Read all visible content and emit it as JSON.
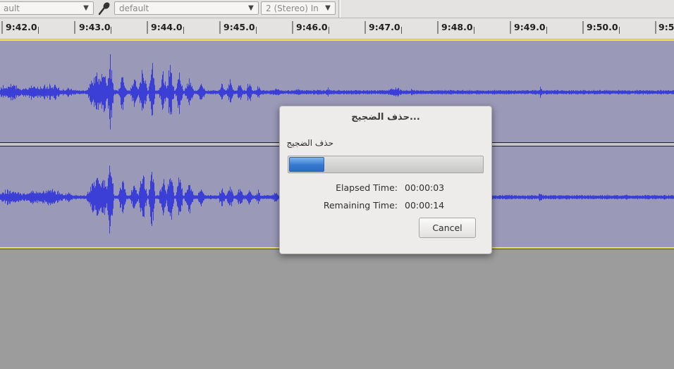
{
  "toolbar": {
    "host_select": "ault",
    "mic_icon": "microphone-icon",
    "input_device_select": "default",
    "channels_select": "2 (Stereo) In"
  },
  "ruler": {
    "ticks": [
      "9:42.0",
      "9:43.0",
      "9:44.0",
      "9:45.0",
      "9:46.0",
      "9:47.0",
      "9:48.0",
      "9:49.0",
      "9:50.0",
      "9:5"
    ]
  },
  "colors": {
    "waveform": "#3b3fd6",
    "track_background": "#9a99b8",
    "selection_line": "#f0e44a",
    "empty_area": "#9c9c9c"
  },
  "dialog": {
    "title": "حذف الضجيج...",
    "message": "حذف الضجيج",
    "progress_fraction": 0.18,
    "elapsed_label": "Elapsed Time:",
    "elapsed_value": "00:00:03",
    "remaining_label": "Remaining Time:",
    "remaining_value": "00:00:14",
    "cancel_label": "Cancel"
  }
}
